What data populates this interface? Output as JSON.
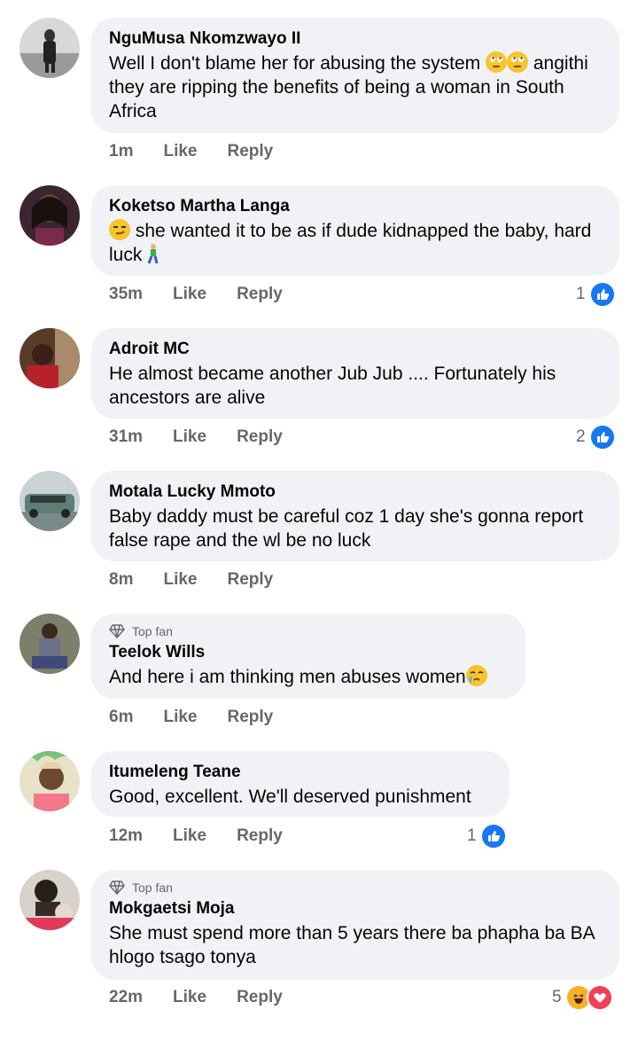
{
  "actions": {
    "like_label": "Like",
    "reply_label": "Reply"
  },
  "badge_label": "Top fan",
  "colors": {
    "bubble": "#f0f2f5",
    "meta": "#65676b",
    "like_blue": "#1877f2",
    "love_red": "#f33e58",
    "haha_yellow": "#f7b125"
  },
  "comments": [
    {
      "name": "NguMusa Nkomzwayo II",
      "text": "Well I don't blame her for abusing the system",
      "text2": "angithi they are ripping the benefits of being a woman in South Africa",
      "emoji": [
        "rolling-eyes-emoji",
        "rolling-eyes-emoji"
      ],
      "time": "1m",
      "reactions": null
    },
    {
      "name": "Koketso Martha Langa",
      "text": "she wanted it to be as if dude kidnapped the baby,",
      "text2": "hard luck",
      "emoji": [
        "smirk-emoji",
        "walking-person-emoji"
      ],
      "time": "35m",
      "reactions": {
        "count": "1",
        "types": [
          "like"
        ]
      }
    },
    {
      "name": "Adroit MC",
      "text": "He almost became another Jub Jub .... Fortunately his ancestors are alive",
      "time": "31m",
      "reactions": {
        "count": "2",
        "types": [
          "like"
        ]
      }
    },
    {
      "name": "Motala Lucky Mmoto",
      "text": "Baby daddy must be careful coz 1 day she's gonna report false rape and the wl be no luck",
      "time": "8m",
      "reactions": null
    },
    {
      "name": "Teelok Wills",
      "top_fan": true,
      "text": "And here i am thinking men abuses women",
      "emoji": [
        "crying-face-emoji"
      ],
      "time": "6m",
      "reactions": null
    },
    {
      "name": "Itumeleng Teane",
      "text": "Good, excellent. We'll deserved punishment",
      "time": "12m",
      "reactions": {
        "count": "1",
        "types": [
          "like"
        ]
      }
    },
    {
      "name": "Mokgaetsi Moja",
      "top_fan": true,
      "text": "She must spend more than 5 years there ba phapha ba BA hlogo tsago tonya",
      "time": "22m",
      "reactions": {
        "count": "5",
        "types": [
          "haha",
          "love"
        ]
      }
    }
  ]
}
